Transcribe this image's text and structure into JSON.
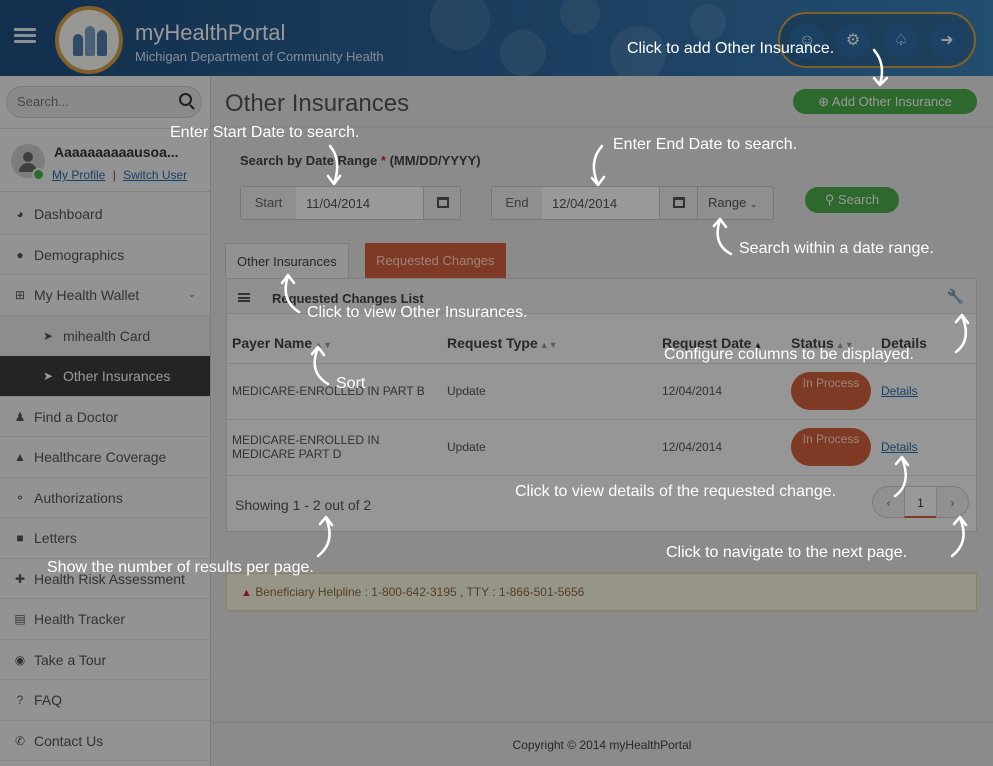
{
  "header": {
    "brand_title": "myHealthPortal",
    "brand_subtitle": "Michigan Department of Community Health",
    "icons": [
      "user-icon",
      "gears-icon",
      "bell-icon",
      "logout-icon"
    ]
  },
  "sidebar": {
    "search_placeholder": "Search...",
    "user_name": "Aaaaaaaaaausoa...",
    "my_profile": "My Profile",
    "separator": "|",
    "switch_user": "Switch User",
    "items": [
      {
        "label": "Dashboard",
        "icon": "dashboard-icon"
      },
      {
        "label": "Demographics",
        "icon": "users-icon"
      },
      {
        "label": "My Health Wallet",
        "icon": "plus-square-icon"
      },
      {
        "label": "mihealth Card",
        "icon": "circle-chevron-icon"
      },
      {
        "label": "Other Insurances",
        "icon": "circle-chevron-icon"
      },
      {
        "label": "Find a Doctor",
        "icon": "user-md-icon"
      },
      {
        "label": "Healthcare Coverage",
        "icon": "thumbs-up-icon"
      },
      {
        "label": "Authorizations",
        "icon": "key-icon"
      },
      {
        "label": "Letters",
        "icon": "file-icon"
      },
      {
        "label": "Health Risk Assessment",
        "icon": "medkit-icon"
      },
      {
        "label": "Health Tracker",
        "icon": "clipboard-icon"
      },
      {
        "label": "Take a Tour",
        "icon": "compass-icon"
      },
      {
        "label": "FAQ",
        "icon": "question-icon"
      },
      {
        "label": "Contact Us",
        "icon": "phone-icon"
      }
    ]
  },
  "main": {
    "page_title": "Other Insurances",
    "add_button": "Add Other Insurance",
    "date_range_label": "Search by Date Range",
    "required_mark": "*",
    "date_format": "(MM/DD/YYYY)",
    "start_label": "Start",
    "start_value": "11/04/2014",
    "end_label": "End",
    "end_value": "12/04/2014",
    "range_label": "Range",
    "search_button": "Search",
    "tabs": [
      "Other Insurances",
      "Requested Changes"
    ],
    "list_title": "Requested Changes List",
    "columns": [
      "Payer Name",
      "Request Type",
      "Request Date",
      "Status",
      "Details"
    ],
    "rows": [
      {
        "payer": "MEDICARE-ENROLLED IN PART B",
        "type": "Update",
        "date": "12/04/2014",
        "status": "In Process",
        "details": "Details"
      },
      {
        "payer": "MEDICARE-ENROLLED IN MEDICARE PART D",
        "type": "Update",
        "date": "12/04/2014",
        "status": "In Process",
        "details": "Details"
      }
    ],
    "showing": "Showing 1 - 2 out of 2",
    "current_page": "1",
    "helpline": "Beneficiary Helpline : 1-800-642-3195 , TTY : 1-866-501-5656",
    "footer": "Copyright © 2014 myHealthPortal"
  },
  "annotations": {
    "add": "Click to add Other Insurance.",
    "start": "Enter Start Date to search.",
    "end": "Enter End Date to search.",
    "range": "Search within a date range.",
    "tab": "Click to view Other Insurances.",
    "config": "Configure columns to be displayed.",
    "sort": "Sort",
    "details": "Click to view details of the requested change.",
    "per_page": "Show the number of results per page.",
    "next": "Click to navigate to the next page."
  },
  "colors": {
    "accent_green": "#4cae4c",
    "tab_orange": "#d4623f",
    "header_blue": "#2f6aa1",
    "link_blue": "#2a6fb0"
  }
}
